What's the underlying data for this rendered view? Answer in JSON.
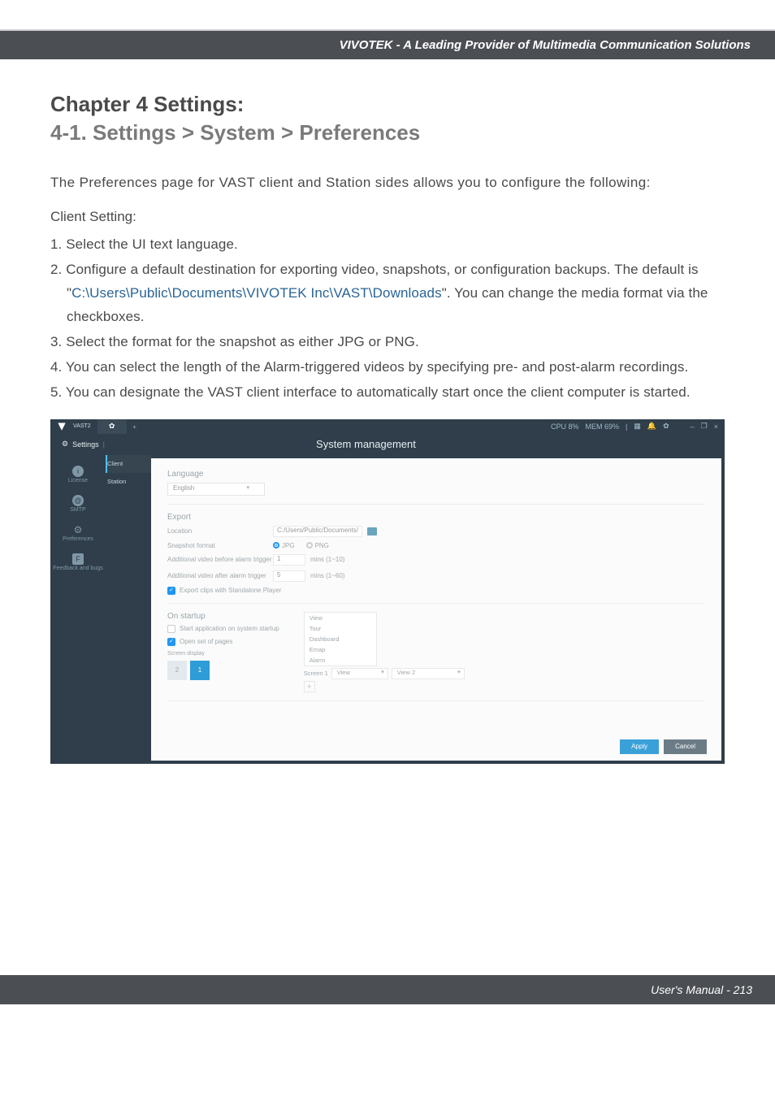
{
  "banner": "VIVOTEK - A Leading Provider of Multimedia Communication Solutions",
  "heading_line1": "Chapter 4 Settings:",
  "heading_line2": "4-1. Settings > System > Preferences",
  "intro": "The Preferences page for VAST client and Station sides allows you to configure the following:",
  "client_setting_label": "Client Setting:",
  "items": {
    "i1": "1. Select the UI text language.",
    "i2a": "2. Configure a default destination for exporting video, snapshots, or configuration backups. The default is \"",
    "i2path": "C:\\Users\\Public\\Documents\\VIVOTEK Inc\\VAST\\Downloads",
    "i2b": "\". You can change the media format via the checkboxes.",
    "i3": "3. Select the format for the snapshot as either JPG or PNG.",
    "i4": "4. You can select the length of the Alarm-triggered videos by specifying pre- and post-alarm recordings.",
    "i5": "5. You can designate the VAST client interface to automatically start once the client computer is started."
  },
  "ss": {
    "app": "VAST2",
    "top_stats": {
      "cpu": "CPU 8%",
      "mem": "MEM 69%"
    },
    "win_icons": {
      "min": "–",
      "sq": "❐",
      "close": "×"
    },
    "settings_label": "Settings",
    "page_title": "System management",
    "left": {
      "license": "License",
      "smtp": "SMTP",
      "preferences": "Preferences",
      "feedback": "Feedback and bugs"
    },
    "tabs": {
      "client": "Client",
      "station": "Station"
    },
    "lang_section": "Language",
    "lang_value": "English",
    "export_section": "Export",
    "location_label": "Location",
    "location_value": "C:/Users/Public/Documents/",
    "snapshot_label": "Snapshot format",
    "fmt_jpg": "JPG",
    "fmt_png": "PNG",
    "pre_label": "Additional video before alarm trigger",
    "pre_val": "1",
    "pre_hint": "mins (1~10)",
    "post_label": "Additional video after alarm trigger",
    "post_val": "5",
    "post_hint": "mins (1~60)",
    "export_clips": "Export clips with Standalone Player",
    "startup_section": "On startup",
    "start_app": "Start application on system startup",
    "open_pages": "Open set of pages",
    "screen_display": "Screen display",
    "chip1": "1",
    "chip2": "2",
    "list": {
      "view": "View",
      "tour": "Tour",
      "dashboard": "Dashboard",
      "emap": "Emap",
      "alarm": "Alarm"
    },
    "screen1_lbl": "Screen 1",
    "screen1_sel": "View",
    "screen1_sel2": "View 2",
    "apply": "Apply",
    "cancel": "Cancel"
  },
  "footer": "User's Manual - 213"
}
